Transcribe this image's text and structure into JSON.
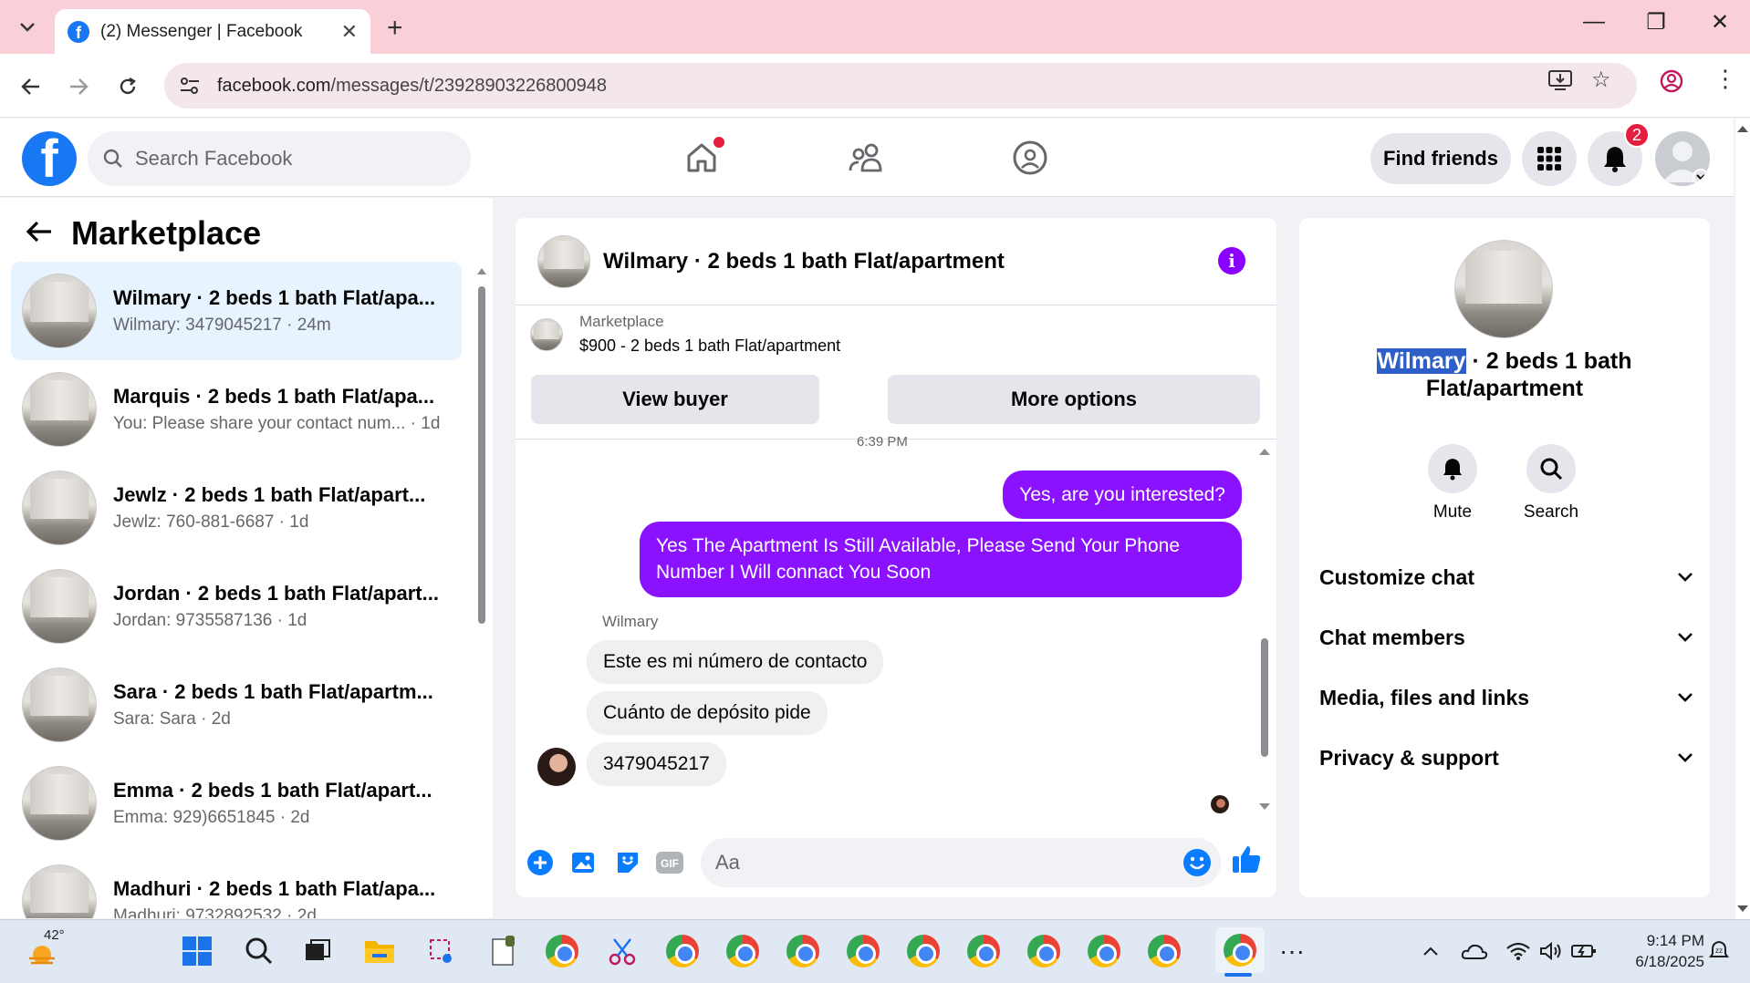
{
  "browser": {
    "tab_title": "(2) Messenger | Facebook",
    "url_domain": "facebook.com",
    "url_path": "/messages/t/23928903226800948"
  },
  "fb": {
    "search_placeholder": "Search Facebook",
    "find_friends": "Find friends",
    "notif_count": "2"
  },
  "sidebar": {
    "header": "Marketplace",
    "conversations": [
      {
        "title": "Wilmary · 2 beds 1 bath Flat/apa...",
        "sub": "Wilmary: 3479045217 · 24m"
      },
      {
        "title": "Marquis · 2 beds 1 bath Flat/apa...",
        "sub": "You: Please share your contact num... · 1d"
      },
      {
        "title": "Jewlz · 2 beds 1 bath Flat/apart...",
        "sub": "Jewlz: 760-881-6687 · 1d"
      },
      {
        "title": "Jordan · 2 beds 1 bath Flat/apart...",
        "sub": "Jordan: 9735587136 · 1d"
      },
      {
        "title": "Sara · 2 beds 1 bath Flat/apartm...",
        "sub": "Sara: Sara · 2d"
      },
      {
        "title": "Emma · 2 beds 1 bath Flat/apart...",
        "sub": "Emma: 929)6651845 · 2d"
      },
      {
        "title": "Madhuri · 2 beds 1 bath Flat/apa...",
        "sub": "Madhuri: 9732892532 · 2d"
      }
    ]
  },
  "chat": {
    "title": "Wilmary · 2 beds 1 bath Flat/apartment",
    "marketplace_label": "Marketplace",
    "listing": "$900 - 2 beds 1 bath Flat/apartment",
    "view_buyer": "View buyer",
    "more_options": "More options",
    "timestamp_fragment": "6:39 PM",
    "messages_out": [
      "Yes, are you interested?",
      "Yes The Apartment Is Still Available, Please Send Your Phone Number I Will connact You Soon"
    ],
    "sender_name": "Wilmary",
    "messages_in": [
      "Este es mi número de contacto",
      "Cuánto de depósito pide",
      "3479045217"
    ],
    "composer_placeholder": "Aa"
  },
  "details": {
    "title_highlight": "Wilmary",
    "title_rest": " · 2 beds 1 bath Flat/apartment",
    "mute": "Mute",
    "search": "Search",
    "rows": [
      "Customize chat",
      "Chat members",
      "Media, files and links",
      "Privacy & support"
    ]
  },
  "taskbar": {
    "temp": "42°",
    "time": "9:14 PM",
    "date": "6/18/2025"
  }
}
